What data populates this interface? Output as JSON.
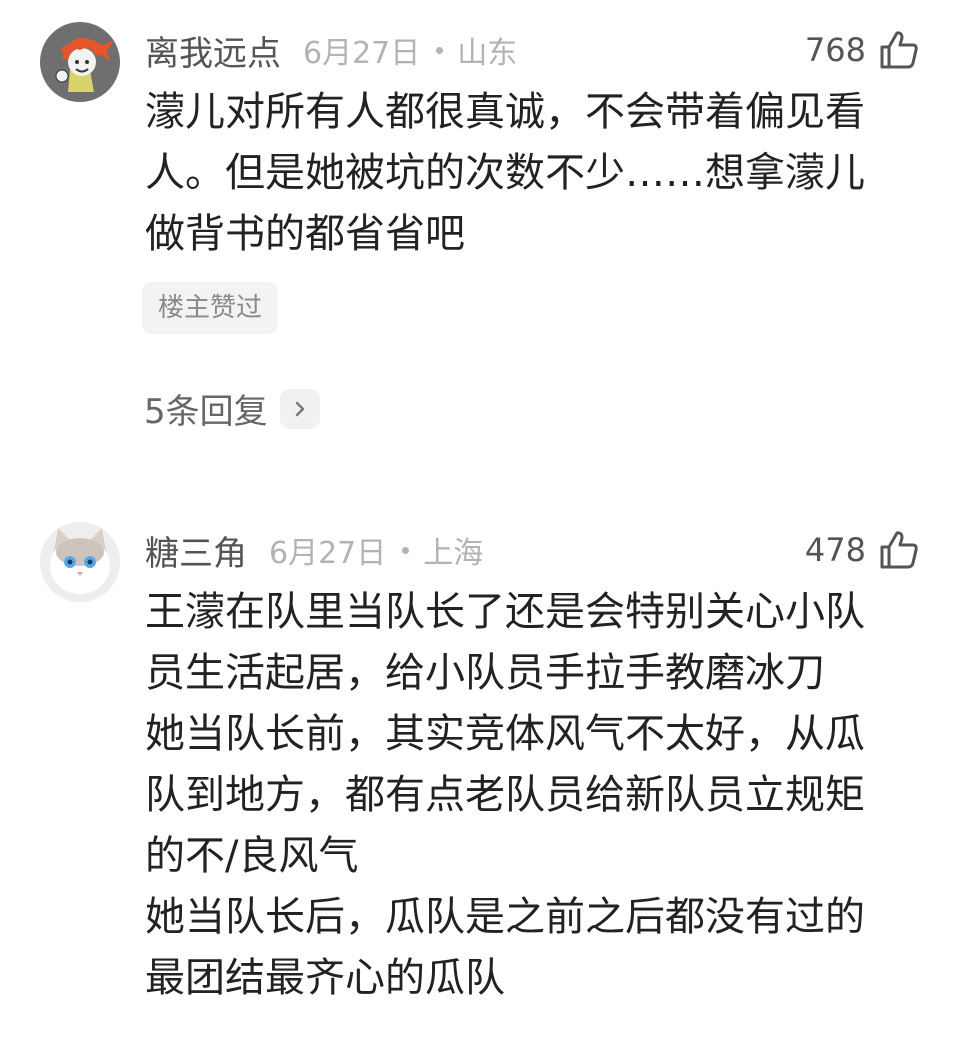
{
  "comments": [
    {
      "username": "离我远点",
      "date": "6月27日",
      "location": "山东",
      "likes": "768",
      "content_lines": [
        "濛儿对所有人都很真诚，不会带着偏见看",
        "人。但是她被坑的次数不少……想拿濛儿",
        "做背书的都省省吧"
      ],
      "badge": "楼主赞过",
      "replies": "5条回复",
      "avatar_icon": "cartoon-orange-hair-avatar",
      "like_icon": "thumbs-up-icon"
    },
    {
      "username": "糖三角",
      "date": "6月27日",
      "location": "上海",
      "likes": "478",
      "content_lines": [
        "王濛在队里当队长了还是会特别关心小队",
        "员生活起居，给小队员手拉手教磨冰刀",
        "她当队长前，其实竞体风气不太好，从瓜",
        "队到地方，都有点老队员给新队员立规矩",
        "的不/良风气",
        "她当队长后，瓜队是之前之后都没有过的",
        "最团结最齐心的瓜队"
      ],
      "avatar_icon": "white-cat-avatar",
      "like_icon": "thumbs-up-icon"
    }
  ],
  "colors": {
    "username": "#555555",
    "meta": "#b3b3b3",
    "content": "#222222",
    "badge_bg": "#f3f3f3",
    "badge_text": "#8a8a8a"
  }
}
